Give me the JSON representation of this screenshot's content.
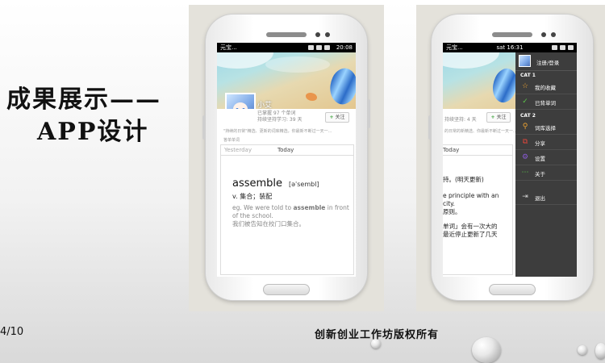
{
  "slide": {
    "title_line1": "成果展示——",
    "title_line2": "APP设计",
    "page_number": "4/10",
    "copyright": "创新创业工作坊版权所有"
  },
  "phone_left": {
    "status": {
      "carrier": "元宝...",
      "time": "20:08"
    },
    "profile": {
      "username": "小艾",
      "stat_learned": "已掌握 97 个单词",
      "stat_days": "持续坚持学习: 39 天",
      "add_button_plus": "+",
      "add_button_label": "关注",
      "quote": "\"持续的日常\"精选、更新的词库精选，你最新不断过一天一..."
    },
    "section_label": "答单单词",
    "tabs": [
      "Yesterday",
      "Today"
    ],
    "word": {
      "headword": "assemble",
      "phonetic": "[əˈsembl]",
      "definition": "v. 集合；装配",
      "example_en_pre": "eg. We were told to ",
      "example_en_bold": "assemble",
      "example_en_post": " in front of the school.",
      "example_cn": "我们被告知在校门口集合。"
    }
  },
  "phone_right": {
    "status": {
      "carrier": "元宝...",
      "time": "sat 16:31"
    },
    "profile": {
      "stat_days": "持续坚持: 4 天",
      "add_button_plus": "+",
      "add_button_label": "关注",
      "quote": "的日常的新精选、你最新不断过一天一..."
    },
    "tab": "Today",
    "peek_lines": [
      "持。(明天更新)",
      "e principle with an",
      "city.",
      "原则。",
      "单词」会有一次大的",
      "最近停止更新了几天"
    ],
    "menu": {
      "login_label": "注册/登录",
      "cat1": "CAT 1",
      "cat2": "CAT 2",
      "items": [
        {
          "label": "我的收藏",
          "icon": "star-icon",
          "color": "#f2a531"
        },
        {
          "label": "已背单词",
          "icon": "check-icon",
          "color": "#5cc54a"
        },
        {
          "label": "词库选择",
          "icon": "search-icon",
          "color": "#f2a531"
        },
        {
          "label": "分享",
          "icon": "share-icon",
          "color": "#e0463a"
        },
        {
          "label": "设置",
          "icon": "gear-icon",
          "color": "#8a5ad6"
        },
        {
          "label": "关于",
          "icon": "dots-icon",
          "color": "#5cc54a"
        },
        {
          "label": "退出",
          "icon": "exit-icon",
          "color": "#cfcfcf"
        }
      ]
    }
  },
  "colors": {
    "accent_green": "#3ca33c",
    "menu_bg": "#3d3d3d",
    "status_bar": "#000000"
  }
}
